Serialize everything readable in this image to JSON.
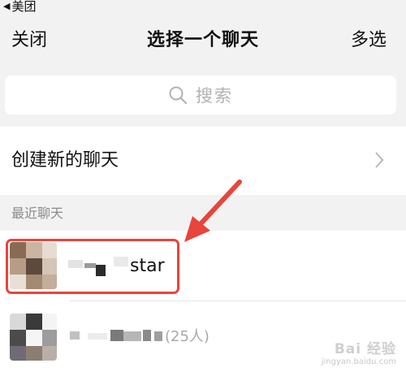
{
  "status_bar": {
    "back_arrow": "◀",
    "back_app_label": "美团"
  },
  "nav": {
    "left_label": "关闭",
    "title": "选择一个聊天",
    "right_label": "多选"
  },
  "search": {
    "icon": "search-icon",
    "placeholder": "搜索"
  },
  "new_chat": {
    "label": "创建新的聊天",
    "icon": "chevron-right-icon"
  },
  "recent": {
    "header": "最近聊天",
    "items": [
      {
        "name_visible": "star",
        "highlighted": true
      },
      {
        "name_visible": "(25人)",
        "highlighted": false
      }
    ]
  },
  "annotation": {
    "color": "#e8453c"
  },
  "watermark": {
    "main": "Bai 经验",
    "sub": "jingyan.baidu.com"
  }
}
